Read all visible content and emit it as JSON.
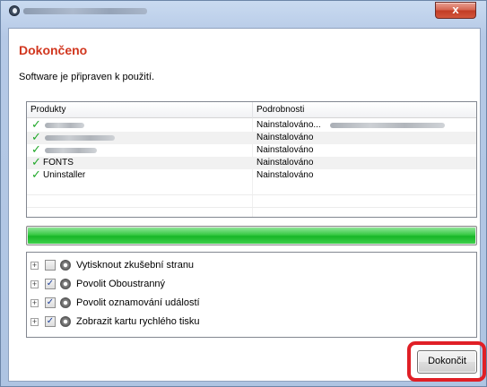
{
  "window": {
    "close_label": "x",
    "accent_color": "#d1361e"
  },
  "header": {
    "title": "Dokončeno",
    "subtitle": "Software je připraven k použití."
  },
  "product_list": {
    "columns": [
      "Produkty",
      "Podrobnosti"
    ],
    "rows": [
      {
        "name": "",
        "detail": "Nainstalováno..."
      },
      {
        "name": "",
        "detail": "Nainstalováno"
      },
      {
        "name": "",
        "detail": "Nainstalováno"
      },
      {
        "name": "FONTS",
        "detail": "Nainstalováno"
      },
      {
        "name": "Uninstaller",
        "detail": "Nainstalováno"
      }
    ],
    "check_icon": "green-checkmark-icon"
  },
  "progress": {
    "value": 1.0,
    "color": "#23bd32"
  },
  "options": {
    "items": [
      {
        "label": "Vytisknout zkušební stranu",
        "checked": false
      },
      {
        "label": "Povolit Oboustranný",
        "checked": true
      },
      {
        "label": "Povolit oznamování událostí",
        "checked": true
      },
      {
        "label": "Zobrazit kartu rychlého tisku",
        "checked": true
      }
    ]
  },
  "footer": {
    "finish_label": "Dokončit",
    "highlight_color": "#e01f26"
  }
}
